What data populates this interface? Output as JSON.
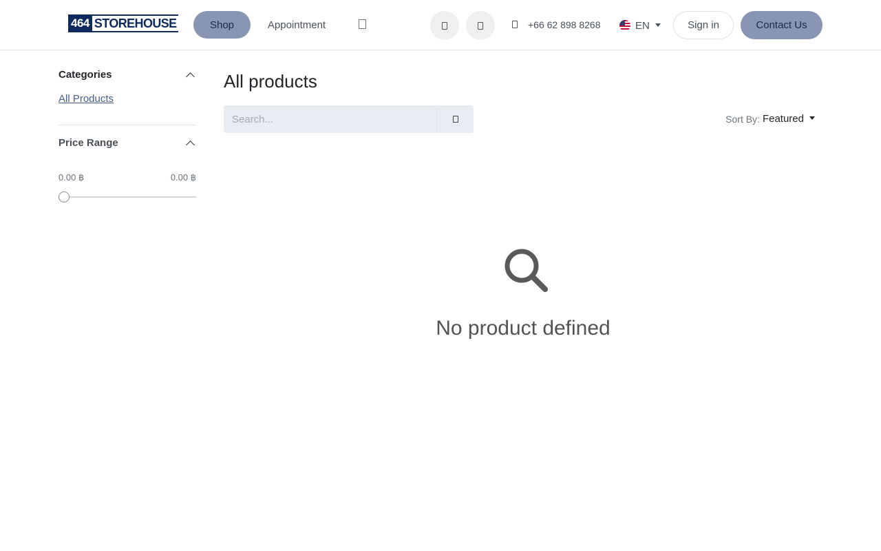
{
  "header": {
    "logo": {
      "number": "464",
      "text": "STOREHOUSE"
    },
    "nav": {
      "shop_label": "Shop",
      "appointment_label": "Appointment"
    },
    "phone": "+66 62 898 8268",
    "language": "EN",
    "signin_label": "Sign in",
    "contact_label": "Contact Us",
    "icons": {
      "nav_extra": "search-icon",
      "cart": "cart-icon",
      "wishlist": "heart-icon",
      "phone": "phone-icon",
      "flag": "us-flag-icon"
    },
    "colors": {
      "accent": "#8896b4",
      "brand": "#0f2a5c"
    }
  },
  "sidebar": {
    "categories_title": "Categories",
    "categories": [
      {
        "label": "All Products"
      }
    ],
    "price_title": "Price Range",
    "price_min": "0.00 ฿",
    "price_max": "0.00 ฿",
    "price_slider_value": 0
  },
  "main": {
    "title": "All products",
    "search": {
      "placeholder": "Search...",
      "value": ""
    },
    "sort_label": "Sort By:",
    "sort_value": "Featured",
    "empty_message": "No product defined"
  }
}
